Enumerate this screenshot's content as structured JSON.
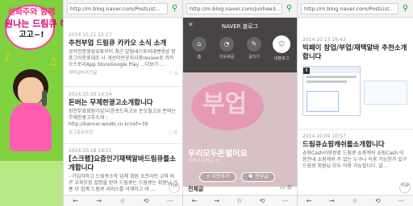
{
  "promo": {
    "line1": "선화주와 함께",
    "line2": "원나는 드림큐 하러",
    "line3": "고고~!"
  },
  "panel1": {
    "url": "http://m.blog.naver.com/PostList...",
    "posts": [
      {
        "date": "2014.10.21 15:27",
        "title": "추천부업 드림큐 카카오 소식 소개",
        "snippet": "공식인증영상유튜브의 최근 알림내스토리내밴넷상 장포그아웃포대조 나 개선이던곳지사항review로 카카오스토리App StoreGoogle Play ...더보기 ...",
        "category": "재택알바추천글",
        "likes": "♡ 0",
        "comments": "0"
      },
      {
        "date": "2014.10.20 14:54",
        "title": "돈버는 무제한광고소개합니다",
        "snippet": "완전무료회원가입!다운로드하고요 돈도벌고요 돈버는 무제한광고추소개 : http://banner.woobi.co.kr/ref=39",
        "category": "광고홍보부업",
        "likes": "♡ 0",
        "comments": "0"
      },
      {
        "date": "2014.10.18 19:51",
        "title": "[스크랩]요즘인기재택알바드림큐를소개합니다",
        "snippet": "- 가입자하고 드림큐소작 업체 회원 오프라인 교육 바르 교육모집 설명을 받아 드림큐는 드림큐는 회원님 서 홍 더 업계 드림큐 서비스를 이해하고 대 ...",
        "category": "",
        "likes": "",
        "comments": ""
      }
    ],
    "top_label": "TOP",
    "nav": [
      "←",
      "→",
      "☆",
      "⟲",
      "⋯"
    ]
  },
  "panel2": {
    "url": "http://m.blog.naver.com/junhee3...",
    "nav_title": "NAVER 블로그",
    "close": "✕",
    "icons": [
      {
        "glyph": "⌂",
        "label": "홈"
      },
      {
        "glyph": "◔",
        "label": "이웃새글"
      },
      {
        "glyph": "✎",
        "label": "글쓰기"
      },
      {
        "glyph": "☺",
        "label": "내블로그"
      }
    ],
    "hero_text": "부업",
    "blog_name": "우리모두돈벌어요",
    "blog_sub": "짐에서 돈버는 소",
    "add_neighbor": "+ 이웃추가",
    "message": "💬 안부글",
    "list_label": "전체글",
    "list_icons": "▭ ☰",
    "nav": [
      "←",
      "→",
      "☆",
      "⟲",
      "⋯"
    ]
  },
  "panel3": {
    "url": "http://m.blog.naver.com/PostList...",
    "posts": [
      {
        "date": "2014.10.13 19:43",
        "title": "빅페이 창업/부업/재택알바 추천소개합니다",
        "snippet": "",
        "category": "",
        "likes": "",
        "comments": ""
      },
      {
        "date": "2014.10.09 10:57",
        "title": "드림큐쇼핑캐쉬를소개합니다",
        "snippet": "쇼핑Cash이용완료 드림큐 쇼핑캐쉬 쇼핑Cash 이용안내 쇼핑캐쉬 가 있는 누구나 이용 가능한가 있구드림큐 회원님 모두 이용 가능합니다. 알...",
        "category": "",
        "likes": "",
        "comments": ""
      }
    ],
    "badge": "5",
    "top_label": "TOP",
    "nav": [
      "←",
      "→",
      "☆",
      "⟲",
      "⋯"
    ]
  },
  "search_icon": "search-icon"
}
